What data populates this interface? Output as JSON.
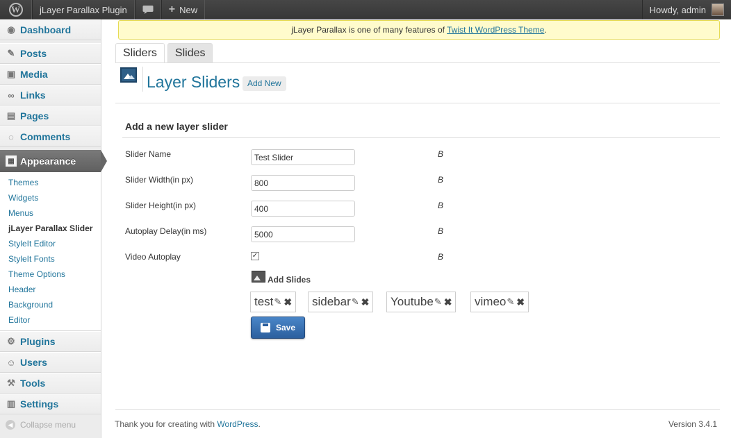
{
  "adminbar": {
    "site_name": "jLayer Parallax Plugin",
    "new_label": "New",
    "howdy": "Howdy, admin",
    "icons": [
      "wordpress-logo-icon",
      "comment-bubble-icon",
      "plus-icon"
    ]
  },
  "sidebar": {
    "top_items": [
      {
        "label": "Dashboard",
        "icon": "dashboard-icon"
      },
      {
        "label": "Posts",
        "icon": "pin-icon"
      },
      {
        "label": "Media",
        "icon": "media-icon"
      },
      {
        "label": "Links",
        "icon": "link-icon"
      },
      {
        "label": "Pages",
        "icon": "pages-icon"
      },
      {
        "label": "Comments",
        "icon": "comments-icon"
      }
    ],
    "active": {
      "label": "Appearance",
      "icon": "appearance-icon"
    },
    "submenu": [
      "Themes",
      "Widgets",
      "Menus",
      "jLayer Parallax Slider",
      "StyleIt Editor",
      "StyleIt Fonts",
      "Theme Options",
      "Header",
      "Background",
      "Editor"
    ],
    "current_submenu": "jLayer Parallax Slider",
    "bottom_items": [
      {
        "label": "Plugins",
        "icon": "plugins-icon"
      },
      {
        "label": "Users",
        "icon": "users-icon"
      },
      {
        "label": "Tools",
        "icon": "tools-icon"
      },
      {
        "label": "Settings",
        "icon": "settings-icon"
      }
    ],
    "collapse_label": "Collapse menu"
  },
  "notice": {
    "prefix": "jLayer Parallax is one of many features of ",
    "link": "Twist It WordPress Theme",
    "suffix": "."
  },
  "tabs": [
    {
      "label": "Sliders",
      "active": true
    },
    {
      "label": "Slides",
      "active": false
    }
  ],
  "header": {
    "title": "Layer Sliders",
    "add_new": "Add New"
  },
  "form": {
    "title": "Add a new layer slider",
    "fields": [
      {
        "label": "Slider Name",
        "value": "Test Slider",
        "note": "B"
      },
      {
        "label": "Slider Width(in px)",
        "value": "800",
        "note": "B"
      },
      {
        "label": "Slider Height(in px)",
        "value": "400",
        "note": "B"
      },
      {
        "label": "Autoplay Delay(in ms)",
        "value": "5000",
        "note": "B"
      }
    ],
    "video_autoplay": {
      "label": "Video Autoplay",
      "checked": true,
      "note": "B"
    },
    "add_slides_label": "Add Slides",
    "slides": [
      "test",
      "sidebar",
      "Youtube",
      "vimeo"
    ],
    "save_label": "Save"
  },
  "footer": {
    "thanks_prefix": "Thank you for creating with ",
    "thanks_link": "WordPress",
    "thanks_suffix": ".",
    "version": "Version 3.4.1"
  },
  "colors": {
    "link": "#21759b",
    "notice_bg": "#fffbcc",
    "save_button": "#2c5f9e"
  }
}
